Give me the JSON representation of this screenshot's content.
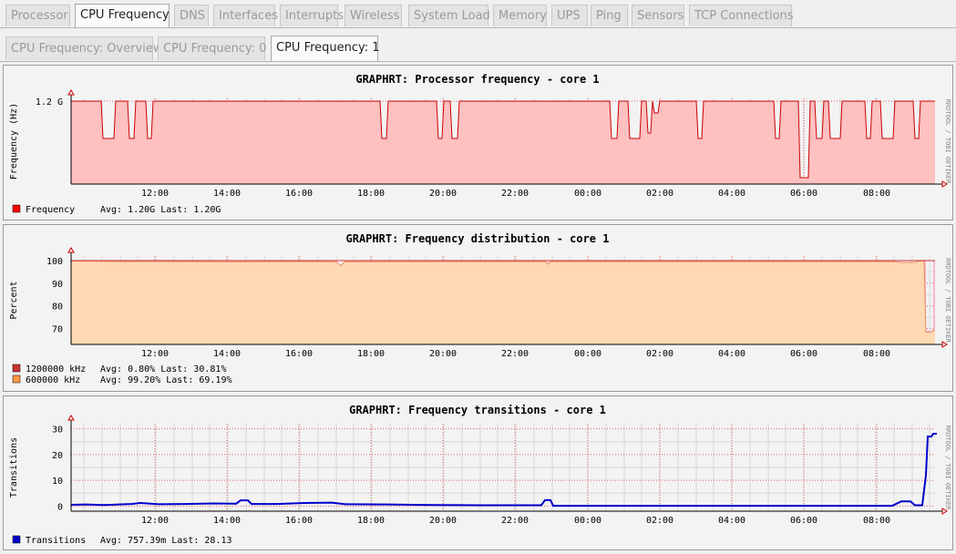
{
  "tabs": [
    "Processor",
    "CPU Frequency",
    "DNS",
    "Interfaces",
    "Interrupts",
    "Wireless",
    "System Load",
    "Memory",
    "UPS",
    "Ping",
    "Sensors",
    "TCP Connections"
  ],
  "active_tab": "CPU Frequency",
  "subtabs": [
    "CPU Frequency: Overview",
    "CPU Frequency: 0",
    "CPU Frequency: 1"
  ],
  "active_subtab": "CPU Frequency: 1",
  "watermark": "RRDTOOL / TOBI OETIKER",
  "time_ticks": [
    "12:00",
    "14:00",
    "16:00",
    "18:00",
    "20:00",
    "22:00",
    "00:00",
    "02:00",
    "04:00",
    "06:00",
    "08:00"
  ],
  "chart_data": [
    {
      "type": "area",
      "title": "GRAPHRT: Processor frequency - core 1",
      "ylabel": "Frequency (Hz)",
      "yticks": [
        "1.2 G"
      ],
      "series": [
        {
          "name": "Frequency",
          "color": "#ff0000",
          "fill": "#ffc0c0",
          "stats": "Avg: 1.20G    Last: 1.20G"
        }
      ]
    },
    {
      "type": "area",
      "title": "GRAPHRT: Frequency distribution - core 1",
      "ylabel": "Percent",
      "yticks": [
        "100",
        "90",
        "80",
        "70"
      ],
      "ylim": [
        63,
        102
      ],
      "series": [
        {
          "name": "1200000 kHz",
          "color": "#cc3333",
          "stats": "Avg:   0.80%    Last:  30.81%"
        },
        {
          "name": "600000 kHz",
          "color": "#ff9944",
          "fill": "#ffd9b3",
          "stats": "Avg:  99.20%    Last:  69.19%"
        }
      ]
    },
    {
      "type": "line",
      "title": "GRAPHRT: Frequency transitions - core 1",
      "ylabel": "Transitions",
      "yticks": [
        "30",
        "20",
        "10",
        "0"
      ],
      "ylim": [
        -2,
        32
      ],
      "series": [
        {
          "name": "Transitions",
          "color": "#0000cc",
          "stats": "Avg: 757.39m    Last: 28.13"
        }
      ]
    }
  ]
}
